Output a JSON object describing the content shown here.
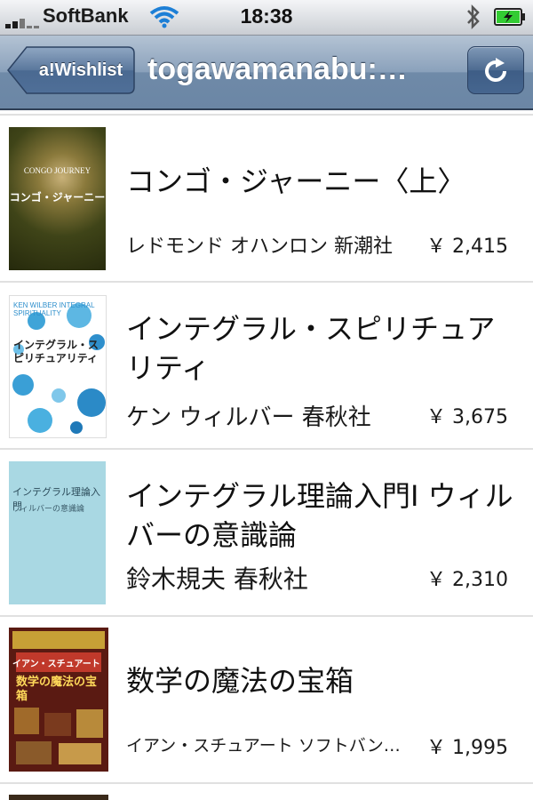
{
  "status_bar": {
    "carrier": "SoftBank",
    "time": "18:38",
    "signal_icon": "signal-bars-icon",
    "wifi_icon": "wifi-icon",
    "bluetooth_icon": "bluetooth-icon",
    "battery_icon": "battery-charging-icon",
    "battery_color": "#33cc33"
  },
  "nav": {
    "back_label": "a!Wishlist",
    "title": "togawamanabu:…",
    "refresh_icon": "refresh-icon",
    "bar_color": "#6f8aa8"
  },
  "items": [
    {
      "title": "コンゴ・ジャーニー〈上〉",
      "meta": "レドモンド オハンロン  新潮社",
      "price": "￥ 2,415",
      "cover": {
        "bg": "#4a4a1a",
        "small_text": "CONGO JOURNEY",
        "jp_text": "コンゴ・ジャーニー"
      }
    },
    {
      "title": "インテグラル・スピリチュアリティ",
      "meta": "ケン ウィルバー  春秋社",
      "price": "￥ 3,675",
      "cover": {
        "bg": "#ffffff",
        "small_text": "KEN WILBER INTEGRAL SPIRITUALITY",
        "jp_text": "インテグラル・スピリチュアリティ"
      }
    },
    {
      "title": "インテグラル理論入門I ウィルバーの意識論",
      "meta": "鈴木規夫  春秋社",
      "price": "￥ 2,310",
      "cover": {
        "bg": "#a9d8e3",
        "jp_text": "インテグラル理論入門",
        "sub_text": "ウィルバーの意識論"
      }
    },
    {
      "title": "数学の魔法の宝箱",
      "meta": "イアン・スチュアート  ソフトバンク クリエイティブ",
      "price": "￥ 1,995",
      "cover": {
        "bg": "#5a1a12",
        "jp_author": "イアン・スチュアート",
        "jp_text": "数学の魔法の宝箱"
      }
    }
  ]
}
